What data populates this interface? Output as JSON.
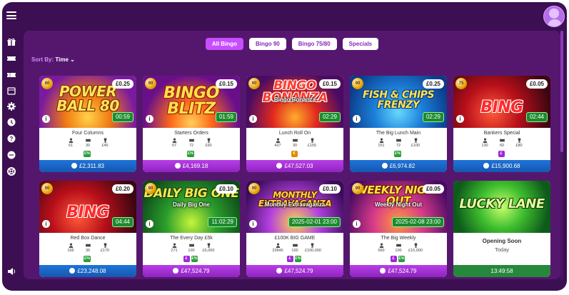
{
  "tabs": [
    "All Bingo",
    "Bingo 90",
    "Bingo 75/80",
    "Specials"
  ],
  "sort": {
    "label": "Sort By:",
    "value": "Time"
  },
  "sidebar_icons": [
    "gift-icon",
    "ticket-icon",
    "ticket-alt-icon",
    "calendar-icon",
    "settings-icon",
    "clock-icon",
    "help-icon",
    "chat-icon",
    "lifebuoy-icon"
  ],
  "colors": {
    "frame": "#3b0f52",
    "panel": "#55176e",
    "accent": "#c74dff",
    "jackpot_purple": "#9a2ccc",
    "jackpot_blue": "#1a63c3",
    "time_green": "#1d8a2e"
  },
  "cards": [
    {
      "banner": "POWER BALL 80",
      "ball": "80",
      "price": "£0.25",
      "time": "00:59",
      "name": "Four Columns",
      "players": "61",
      "tickets": "30",
      "prize": "£45",
      "features": [
        "pound-tag"
      ],
      "jackpot": "£2,311.83",
      "jackpot_style": "blue",
      "subtitle": ""
    },
    {
      "banner": "BINGO BLITZ",
      "ball": "90",
      "price": "£0.15",
      "time": "01:59",
      "name": "Starters Orders",
      "players": "67",
      "tickets": "72",
      "prize": "£60",
      "features": [
        "pound-tag"
      ],
      "jackpot": "£4,169.18",
      "jackpot_style": "purple",
      "subtitle": ""
    },
    {
      "banner": "BINGO BONANZA",
      "ball": "90",
      "price": "£0.15",
      "time": "02:29",
      "name": "Lunch Roll On",
      "players": "427",
      "tickets": "30",
      "prize": "£155",
      "features": [
        "coin"
      ],
      "jackpot": "£47,527.03",
      "jackpot_style": "purple",
      "subtitle": "Bingo Bonanza"
    },
    {
      "banner": "FISH & CHIPS FRENZY",
      "ball": "90",
      "price": "£0.25",
      "time": "02:29",
      "name": "The Big Lunch Main",
      "players": "151",
      "tickets": "72",
      "prize": "£100",
      "features": [
        "pound-tag"
      ],
      "jackpot": "£6,974.82",
      "jackpot_style": "blue",
      "subtitle": ""
    },
    {
      "banner": "BING",
      "ball": "75",
      "price": "£0.05",
      "time": "02:44",
      "name": "Bankers Special",
      "players": "130",
      "tickets": "60",
      "prize": "£80",
      "features": [
        "purple"
      ],
      "jackpot": "£15,900.68",
      "jackpot_style": "blue",
      "subtitle": ""
    },
    {
      "banner": "BING",
      "ball": "90",
      "price": "£0.20",
      "time": "04:44",
      "name": "Red Box Dance",
      "players": "165",
      "tickets": "36",
      "prize": "£170",
      "features": [
        "pound-tag"
      ],
      "jackpot": "£23,248.08",
      "jackpot_style": "blue",
      "subtitle": ""
    },
    {
      "banner": "DAILY BIG ONE",
      "ball": "90",
      "price": "£0.10",
      "time": "11:02:29",
      "name": "The Every Day £5k",
      "players": "271",
      "tickets": "100",
      "prize": "£5,000",
      "features": [
        "purple",
        "pound-tag"
      ],
      "jackpot": "£47,524.79",
      "jackpot_style": "purple",
      "subtitle": "Daily Big One"
    },
    {
      "banner": "MONTHLY EXTRAVAGANZA",
      "ball": "90",
      "price": "£0.10",
      "time": "2025-02-01 23:00",
      "name": "£100K BIG GAME",
      "players": "23646",
      "tickets": "100",
      "prize": "£100,000",
      "features": [
        "purple",
        "pound-tag"
      ],
      "jackpot": "£47,524.79",
      "jackpot_style": "purple",
      "subtitle": "Monthly Extravaganza"
    },
    {
      "banner": "WEEKLY NIGHT OUT",
      "ball": "90",
      "price": "£0.05",
      "time": "2025-02-08 23:00",
      "name": "The Big Weekly",
      "players": "560",
      "tickets": "100",
      "prize": "£15,000",
      "features": [
        "purple",
        "pound-tag"
      ],
      "jackpot": "£47,524.79",
      "jackpot_style": "purple",
      "subtitle": "Weekly Night Out"
    },
    {
      "banner": "LUCKY LANE",
      "opening": "Opening Soon",
      "today": "Today",
      "countdown": "13:49:58",
      "jackpot_style": "green"
    }
  ],
  "features_text": {
    "pound-tag": "£%",
    "purple": "£",
    "coin": "€"
  }
}
